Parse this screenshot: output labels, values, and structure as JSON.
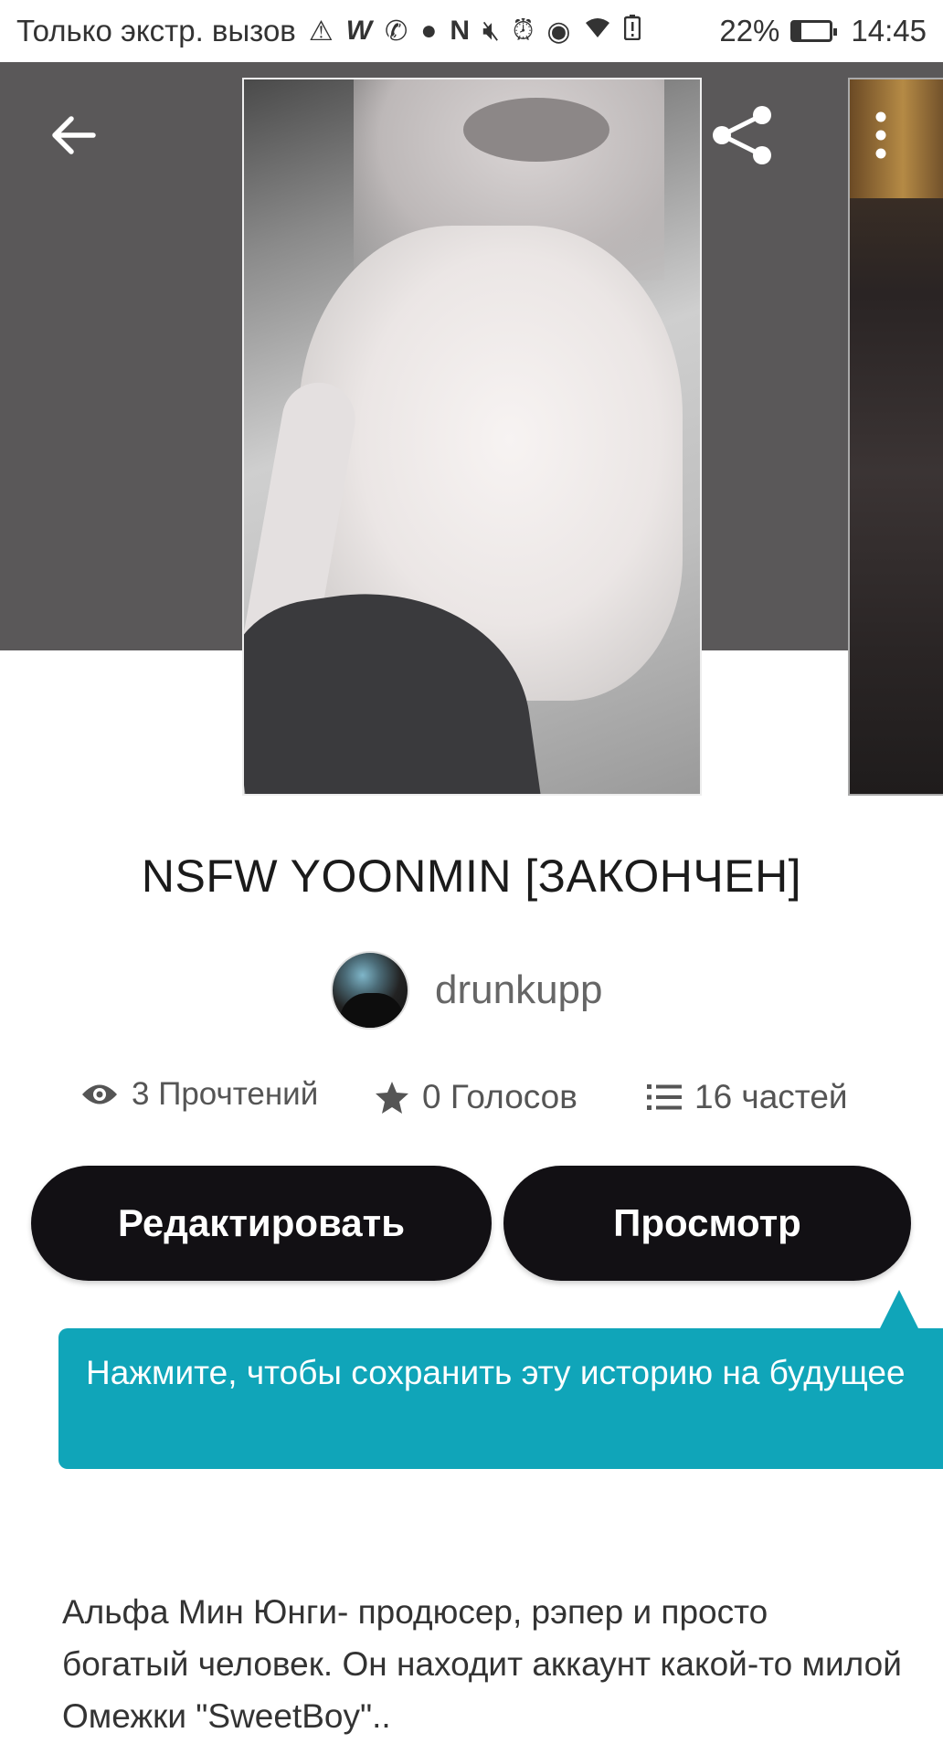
{
  "status_bar": {
    "carrier_text": "Только экстр. вызов",
    "battery_percent": "22%",
    "battery_level": 0.22,
    "time": "14:45",
    "icons": [
      "warning-icon",
      "w-app-icon",
      "viber-icon",
      "chat-icon",
      "nfc-icon",
      "mute-icon",
      "alarm-icon",
      "eye-icon",
      "wifi-icon",
      "battery-alert-icon",
      "battery-icon"
    ]
  },
  "header": {
    "back_icon": "arrow-left-icon",
    "share_icon": "share-icon",
    "more_icon": "more-vertical-icon",
    "band_color": "#5a5859"
  },
  "story": {
    "title": "NSFW YOONMIN [ЗАКОНЧЕН]",
    "author": "drunkupp",
    "stats": {
      "reads": "3 Прочтений",
      "votes": "0 Голосов",
      "parts": "16 частей"
    },
    "description": "Альфа Мин Юнги- продюсер, рэпер и просто богатый человек. Он находит аккаунт какой-то милой Омежки \"SweetBoy\".."
  },
  "actions": {
    "edit_label": "Редактировать",
    "view_label": "Просмотр"
  },
  "tooltip": {
    "text": "Нажмите, чтобы сохранить эту историю на будущее",
    "color": "#10a5b9"
  }
}
